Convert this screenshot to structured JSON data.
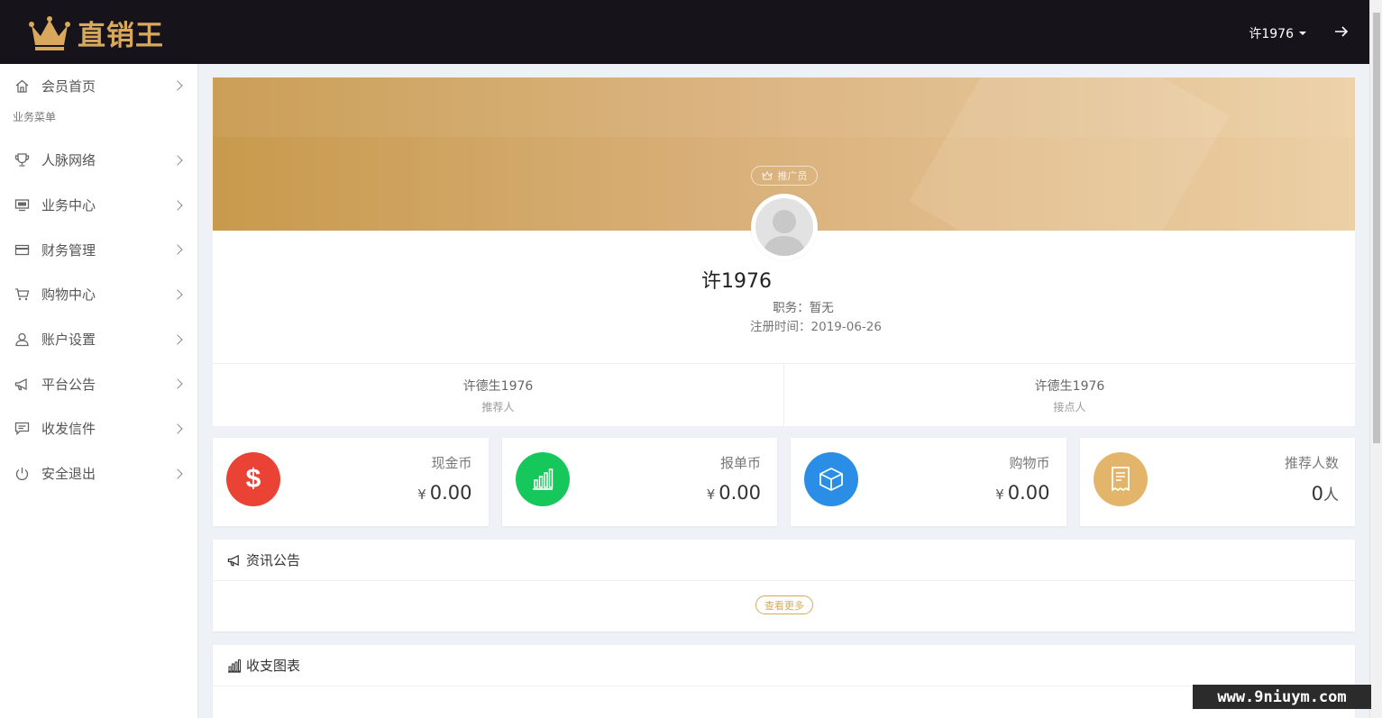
{
  "header": {
    "brand": "直销王",
    "username": "许1976",
    "colors": {
      "bar": "#17131b",
      "brand": "#d8a95d"
    },
    "icons": [
      "crown-logo",
      "caret-down-icon",
      "arrow-right-icon"
    ]
  },
  "sidebar": {
    "home": {
      "label": "会员首页",
      "icon": "home-icon"
    },
    "section": "业务菜单",
    "items": [
      {
        "label": "人脉网络",
        "icon": "trophy-icon"
      },
      {
        "label": "业务中心",
        "icon": "monitor-icon"
      },
      {
        "label": "财务管理",
        "icon": "card-icon"
      },
      {
        "label": "购物中心",
        "icon": "cart-icon"
      },
      {
        "label": "账户设置",
        "icon": "user-icon"
      },
      {
        "label": "平台公告",
        "icon": "megaphone-icon"
      },
      {
        "label": "收发信件",
        "icon": "message-icon"
      },
      {
        "label": "安全退出",
        "icon": "power-icon"
      }
    ]
  },
  "profile": {
    "badge": "推广员",
    "name": "许1976",
    "role": "职务：暂无",
    "register": "注册时间：2019-06-26",
    "referrer": {
      "name": "许德生1976",
      "label": "推荐人"
    },
    "contact": {
      "name": "许德生1976",
      "label": "接点人"
    }
  },
  "stats": [
    {
      "label": "现金币",
      "currency": "¥",
      "value": "0.00",
      "color": "#ea4335",
      "icon": "dollar-icon"
    },
    {
      "label": "报单币",
      "currency": "¥",
      "value": "0.00",
      "color": "#16c75c",
      "icon": "bar-chart-icon"
    },
    {
      "label": "购物币",
      "currency": "¥",
      "value": "0.00",
      "color": "#2b8ee6",
      "icon": "box-icon"
    },
    {
      "label": "推荐人数",
      "value": "0",
      "unit": "人",
      "color": "#e2b56a",
      "icon": "receipt-icon"
    }
  ],
  "news": {
    "title": "资讯公告",
    "more": "查看更多",
    "icon": "megaphone-icon"
  },
  "chart_panel": {
    "title": "收支图表",
    "icon": "bar-chart-icon"
  },
  "watermark": "www.9niuym.com"
}
